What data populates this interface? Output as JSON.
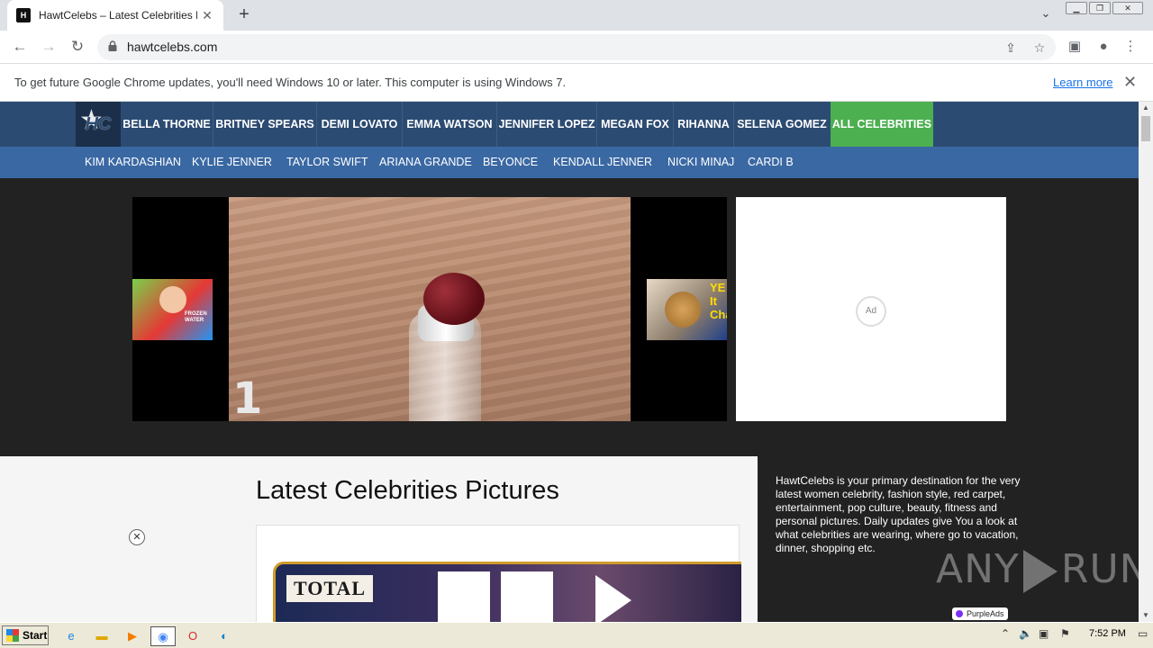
{
  "browser": {
    "tab_title": "HawtCelebs – Latest Celebrities Pictures",
    "favicon_text": "H",
    "url": "hawtcelebs.com",
    "infobar_message": "To get future Google Chrome updates, you'll need Windows 10 or later. This computer is using Windows 7.",
    "infobar_link": "Learn more"
  },
  "site": {
    "logo_text": "HC",
    "nav_primary": [
      {
        "label": "BELLA THORNE"
      },
      {
        "label": "BRITNEY SPEARS"
      },
      {
        "label": "DEMI LOVATO"
      },
      {
        "label": "EMMA WATSON"
      },
      {
        "label": "JENNIFER LOPEZ"
      },
      {
        "label": "MEGAN FOX"
      },
      {
        "label": "RIHANNA"
      },
      {
        "label": "SELENA GOMEZ"
      },
      {
        "label": "ALL CELEBRITIES"
      }
    ],
    "nav_secondary": [
      {
        "label": "KIM KARDASHIAN"
      },
      {
        "label": "KYLIE JENNER"
      },
      {
        "label": "TAYLOR SWIFT"
      },
      {
        "label": "ARIANA GRANDE"
      },
      {
        "label": "BEYONCE"
      },
      {
        "label": "KENDALL JENNER"
      },
      {
        "label": "NICKI MINAJ"
      },
      {
        "label": "CARDI B"
      }
    ],
    "carousel": {
      "slide_number": "1",
      "right_thumb_text": "YE It Cha",
      "left_thumb_text": "FROZEN WATER"
    },
    "ad_label": "Ad",
    "content_title": "Latest Celebrities Pictures",
    "poster_label": "TOTAL",
    "about_text": "HawtCelebs is your primary destination for the very latest women celebrity, fashion style, red carpet, entertainment, pop culture, beauty, fitness and personal pictures. Daily updates give You a look at what celebrities are wearing, where go to vacation, dinner, shopping etc.",
    "watermark_left": "ANY",
    "watermark_right": "RUN",
    "purple_ads": "PurpleAds"
  },
  "taskbar": {
    "start_label": "Start",
    "clock": "7:52 PM"
  },
  "colors": {
    "nav_primary_bg": "#2c4b72",
    "nav_secondary_bg": "#3a68a3",
    "all_celebrities_bg": "#4caf50",
    "link_blue": "#1a73e8"
  }
}
